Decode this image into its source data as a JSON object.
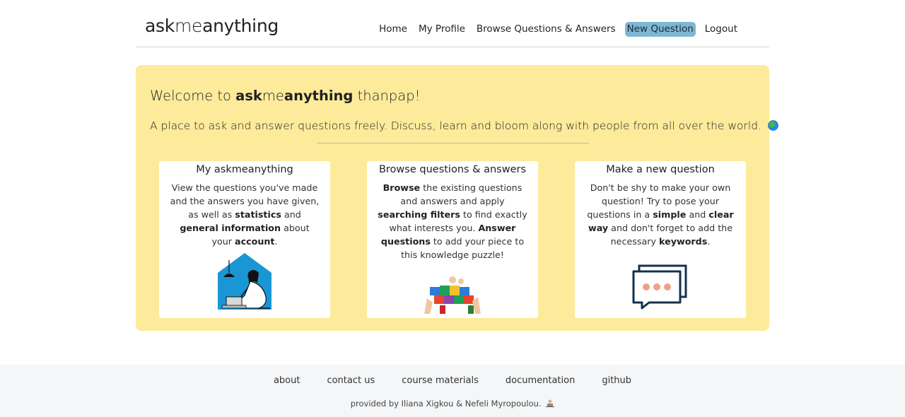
{
  "header": {
    "logo": {
      "part1": "ask",
      "part2": "me",
      "part3": "anything"
    },
    "nav": [
      {
        "label": "Home"
      },
      {
        "label": "My Profile"
      },
      {
        "label": "Browse Questions & Answers"
      },
      {
        "label": "New Question",
        "active": true
      },
      {
        "label": "Logout"
      }
    ]
  },
  "welcome": {
    "prefix": "Welcome to ",
    "brand_ask": "ask",
    "brand_me": "me",
    "brand_anything": "anything",
    "username": " thanpap!",
    "lead": "A place to ask and answer questions freely. Discuss, learn and bloom along with people from all over the world.",
    "lead_icon": "globe-icon"
  },
  "cards": [
    {
      "title": "My askmeanything",
      "text": [
        "View the questions you've made and the answers you have given, as well as ",
        "statistics",
        " and ",
        "general information",
        " about your ",
        "account",
        "."
      ],
      "icon": "person-with-laptop-illustration"
    },
    {
      "title": "Browse questions & answers",
      "text": [
        "Browse",
        " the existing questions and answers and apply ",
        "searching filters",
        " to find exactly what interests you. ",
        "Answer questions",
        " to add your piece to this knowledge puzzle!"
      ],
      "icon": "puzzle-hands-illustration"
    },
    {
      "title": "Make a new question",
      "text": [
        "Don't be shy to make your own question! Try to pose your questions in a ",
        "simple",
        " and ",
        "clear way",
        " and don't forget to add the necessary ",
        "keywords",
        "."
      ],
      "icon": "chat-bubbles-illustration"
    }
  ],
  "footer": {
    "links": [
      "about",
      "contact us",
      "course materials",
      "documentation",
      "github"
    ],
    "credit": "provided by Iliana Xigkou & Nefeli Myropoulou.",
    "credit_icon": "technologist-icon"
  },
  "colors": {
    "jumbotron": "#fdeb9b",
    "active_nav": "#7db7d4",
    "footer_bg": "#f5f6f7"
  }
}
